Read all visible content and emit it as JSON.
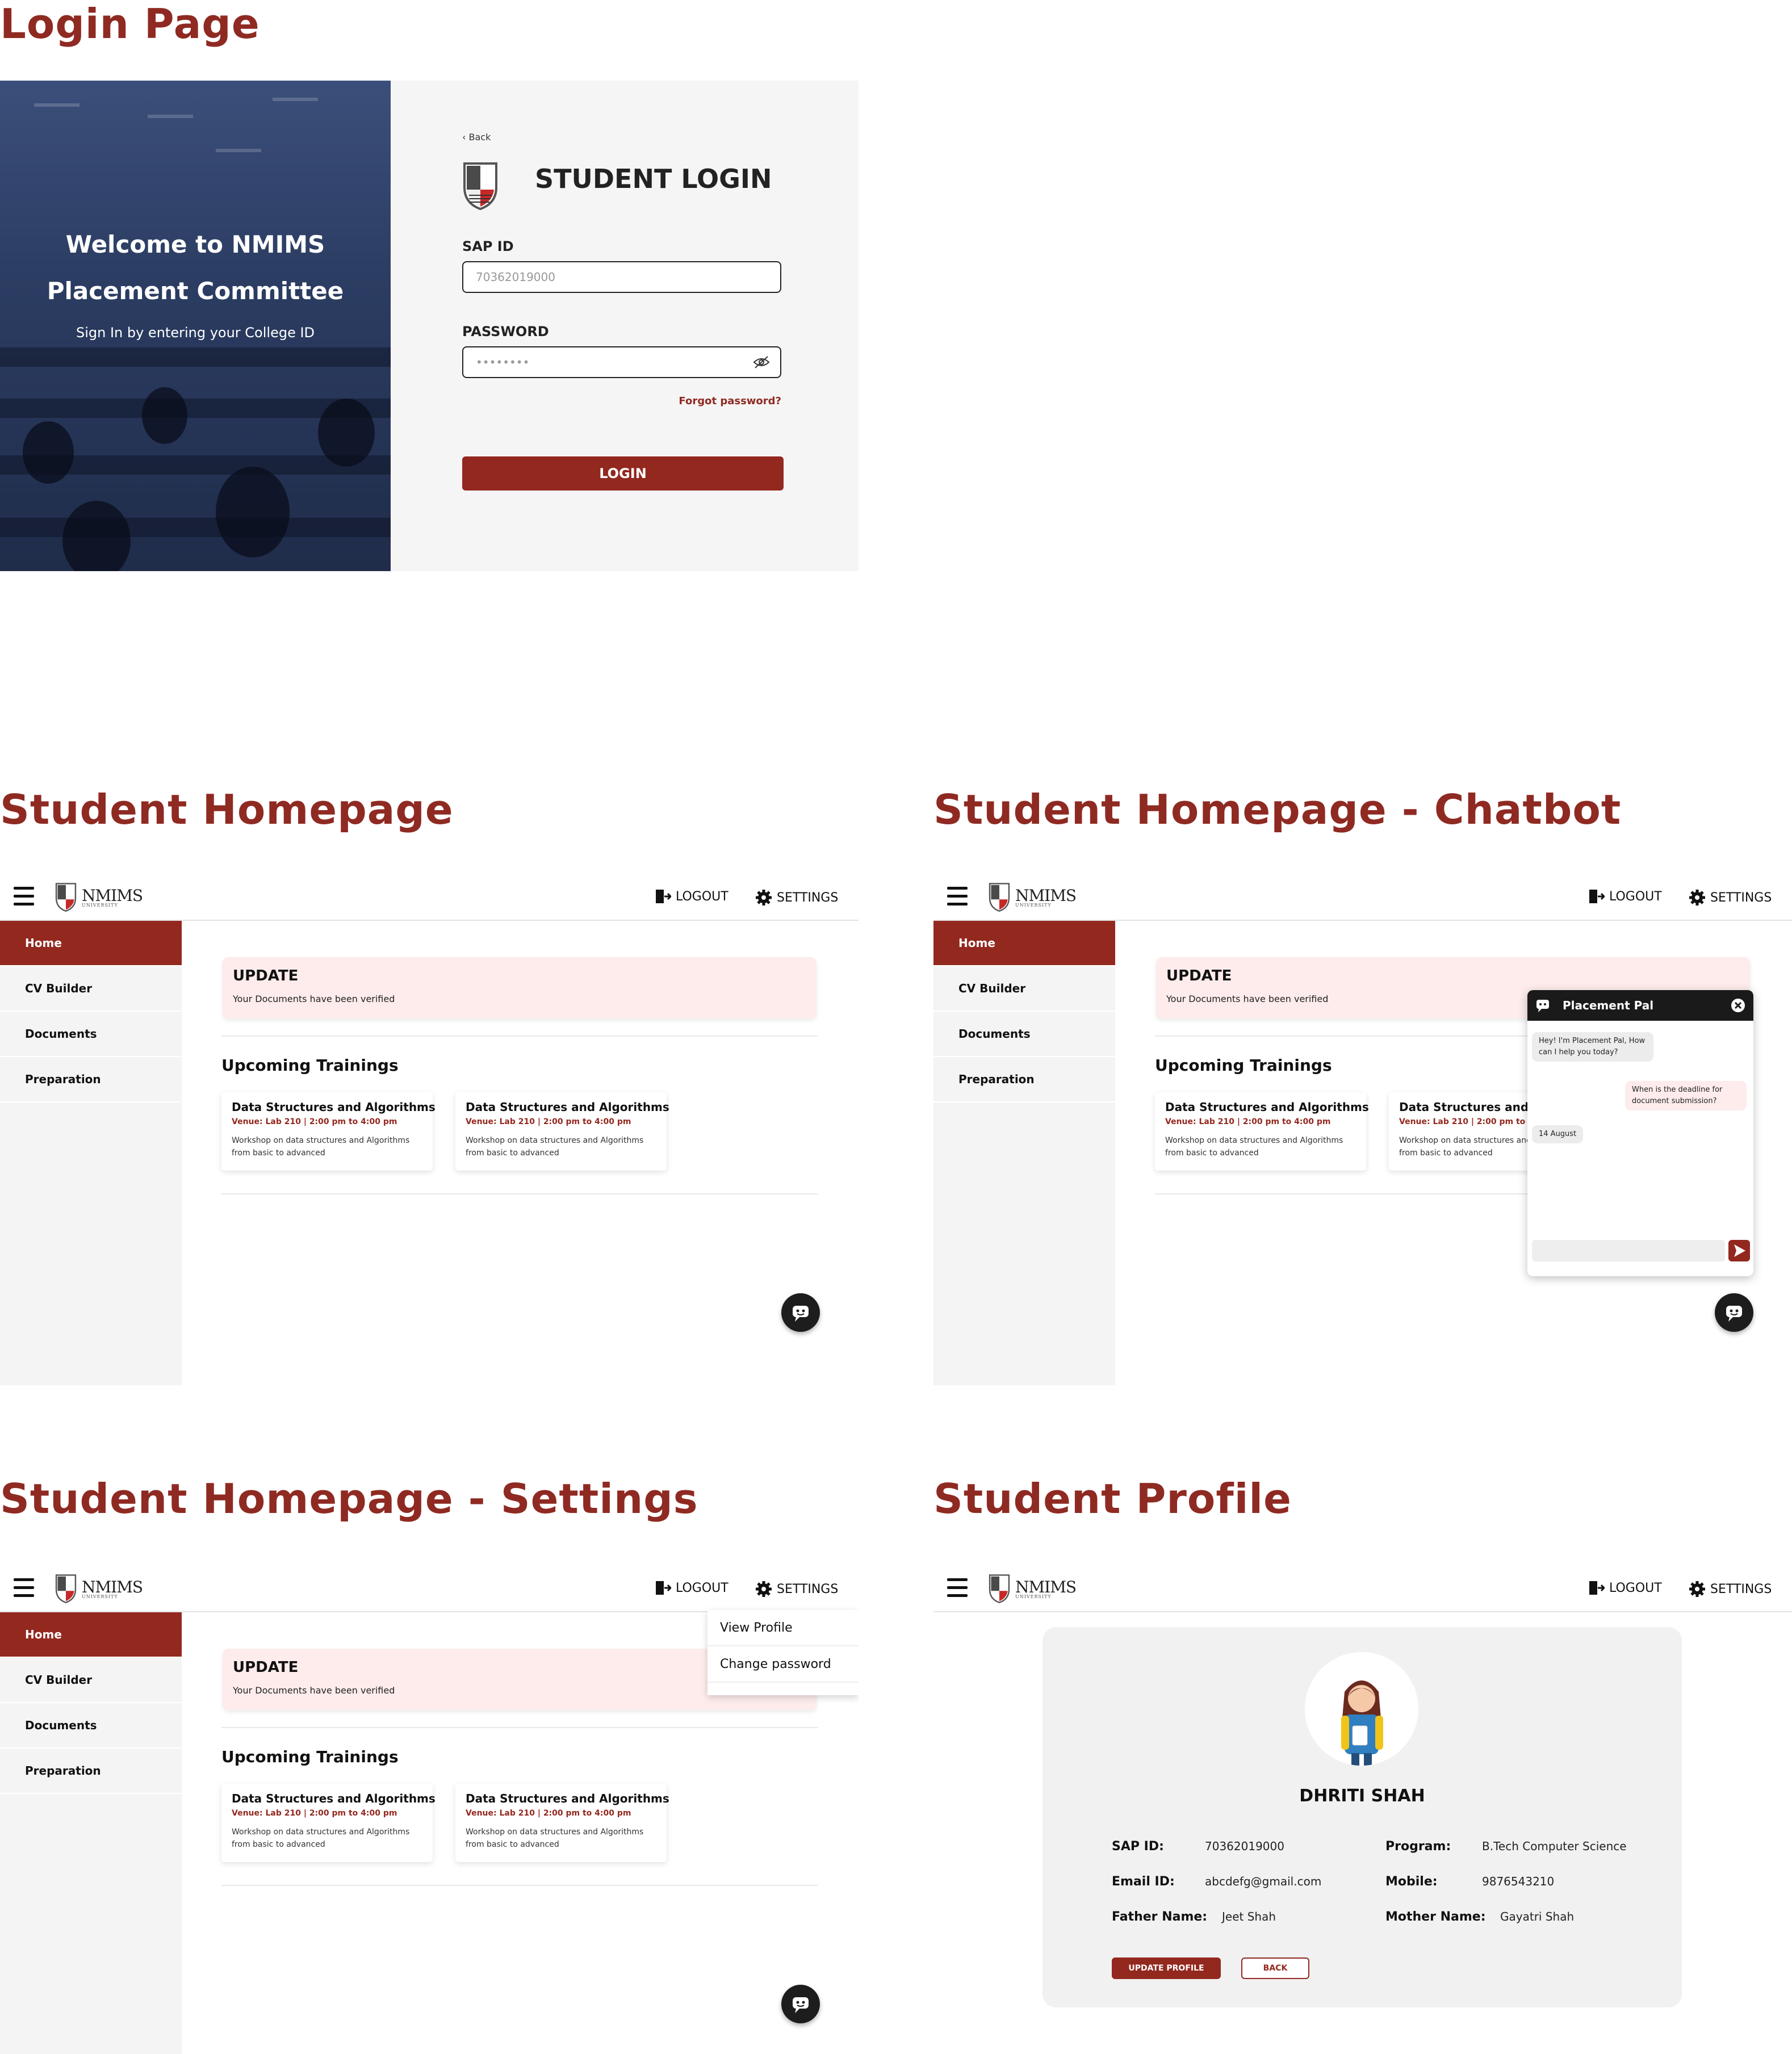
{
  "section_titles": {
    "login": "Login Page",
    "homepage": "Student Homepage",
    "chatbot": "Student Homepage - Chatbot",
    "settings": "Student Homepage - Settings",
    "profile": "Student Profile"
  },
  "login": {
    "hero_title_line1": "Welcome to NMIMS",
    "hero_title_line2": "Placement Committee",
    "hero_subtitle": "Sign In by entering your College ID",
    "back": "‹ Back",
    "heading": "STUDENT LOGIN",
    "sap_label": "SAP ID",
    "sap_value": "70362019000",
    "password_label": "PASSWORD",
    "password_value": "••••••••",
    "forgot": "Forgot password?",
    "login_button": "LOGIN"
  },
  "app": {
    "logo": "NMIMS",
    "logo_sub": "UNIVERSITY",
    "logout": "LOGOUT",
    "settings": "SETTINGS",
    "nav": [
      "Home",
      "CV Builder",
      "Documents",
      "Preparation"
    ],
    "update_title": "UPDATE",
    "update_text": "Your Documents have been verified",
    "trainings_heading": "Upcoming Trainings",
    "trainings": [
      {
        "title": "Data  Structures and Algorithms",
        "venue": "Venue: Lab 210 | 2:00 pm to 4:00 pm",
        "desc": "Workshop on data structures and Algorithms from basic to advanced"
      },
      {
        "title": "Data  Structures and Algorithms",
        "venue": "Venue: Lab 210 | 2:00 pm to 4:00 pm",
        "desc": "Workshop on data structures and Algorithms from basic to advanced"
      }
    ]
  },
  "chatbot": {
    "title": "Placement Pal",
    "bot_greeting": "Hey! I'm Placement Pal, How can I help you today?",
    "user_message": "When is the deadline for document submission?",
    "bot_reply": "14 August"
  },
  "settings_menu": [
    "View Profile",
    "Change password"
  ],
  "profile": {
    "name": "DHRITI SHAH",
    "sap_label": "SAP ID:",
    "sap_value": "70362019000",
    "program_label": "Program:",
    "program_value": "B.Tech Computer Science",
    "email_label": "Email ID:",
    "email_value": "abcdefg@gmail.com",
    "mobile_label": "Mobile:",
    "mobile_value": "9876543210",
    "father_label": "Father Name:",
    "father_value": "Jeet Shah",
    "mother_label": "Mother Name:",
    "mother_value": "Gayatri Shah",
    "update_button": "UPDATE PROFILE",
    "back_button": "BACK"
  },
  "colors": {
    "brand": "#93281f",
    "title": "#8f2a22",
    "update_bg": "#fdeceb"
  }
}
